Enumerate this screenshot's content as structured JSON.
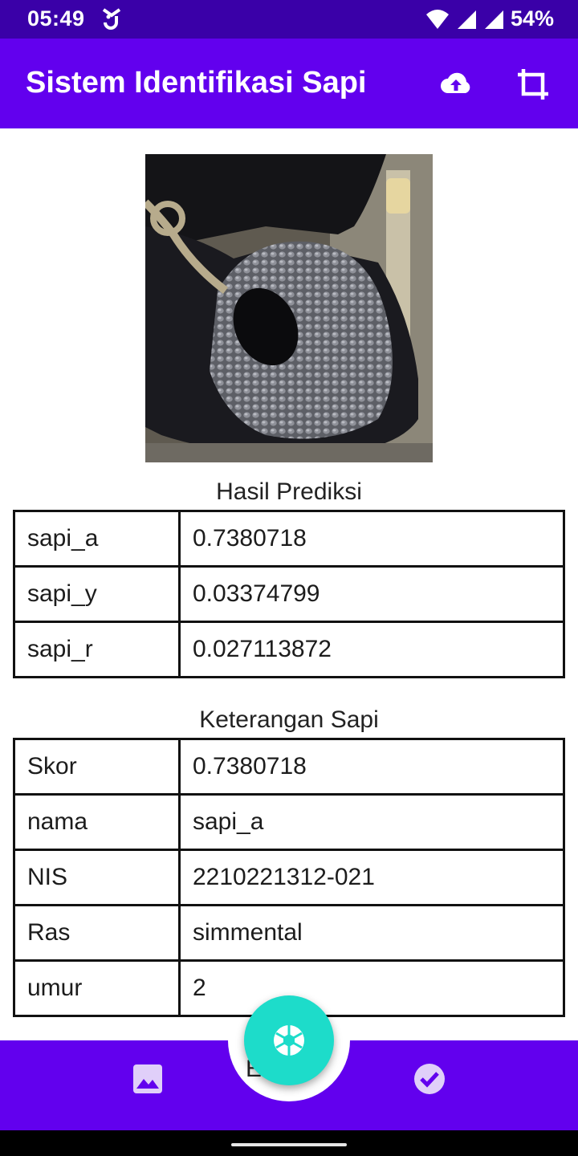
{
  "status_bar": {
    "time": "05:49",
    "battery": "54%"
  },
  "app_bar": {
    "title": "Sistem Identifikasi Sapi"
  },
  "photo": {
    "alt": "cow muzzle photo"
  },
  "prediction": {
    "title": "Hasil Prediksi",
    "rows": [
      {
        "label": "sapi_a",
        "value": "0.7380718"
      },
      {
        "label": "sapi_y",
        "value": "0.03374799"
      },
      {
        "label": "sapi_r",
        "value": "0.027113872"
      }
    ]
  },
  "details": {
    "title": "Keterangan Sapi",
    "rows": [
      {
        "label": "Skor",
        "value": "0.7380718"
      },
      {
        "label": "nama",
        "value": "sapi_a"
      },
      {
        "label": "NIS",
        "value": "2210221312-021"
      },
      {
        "label": "Ras",
        "value": "simmental"
      },
      {
        "label": "umur",
        "value": "2"
      }
    ],
    "partial_text": "E"
  },
  "colors": {
    "primary": "#6200ee",
    "status": "#3a00a8",
    "fab": "#1ddcca"
  }
}
